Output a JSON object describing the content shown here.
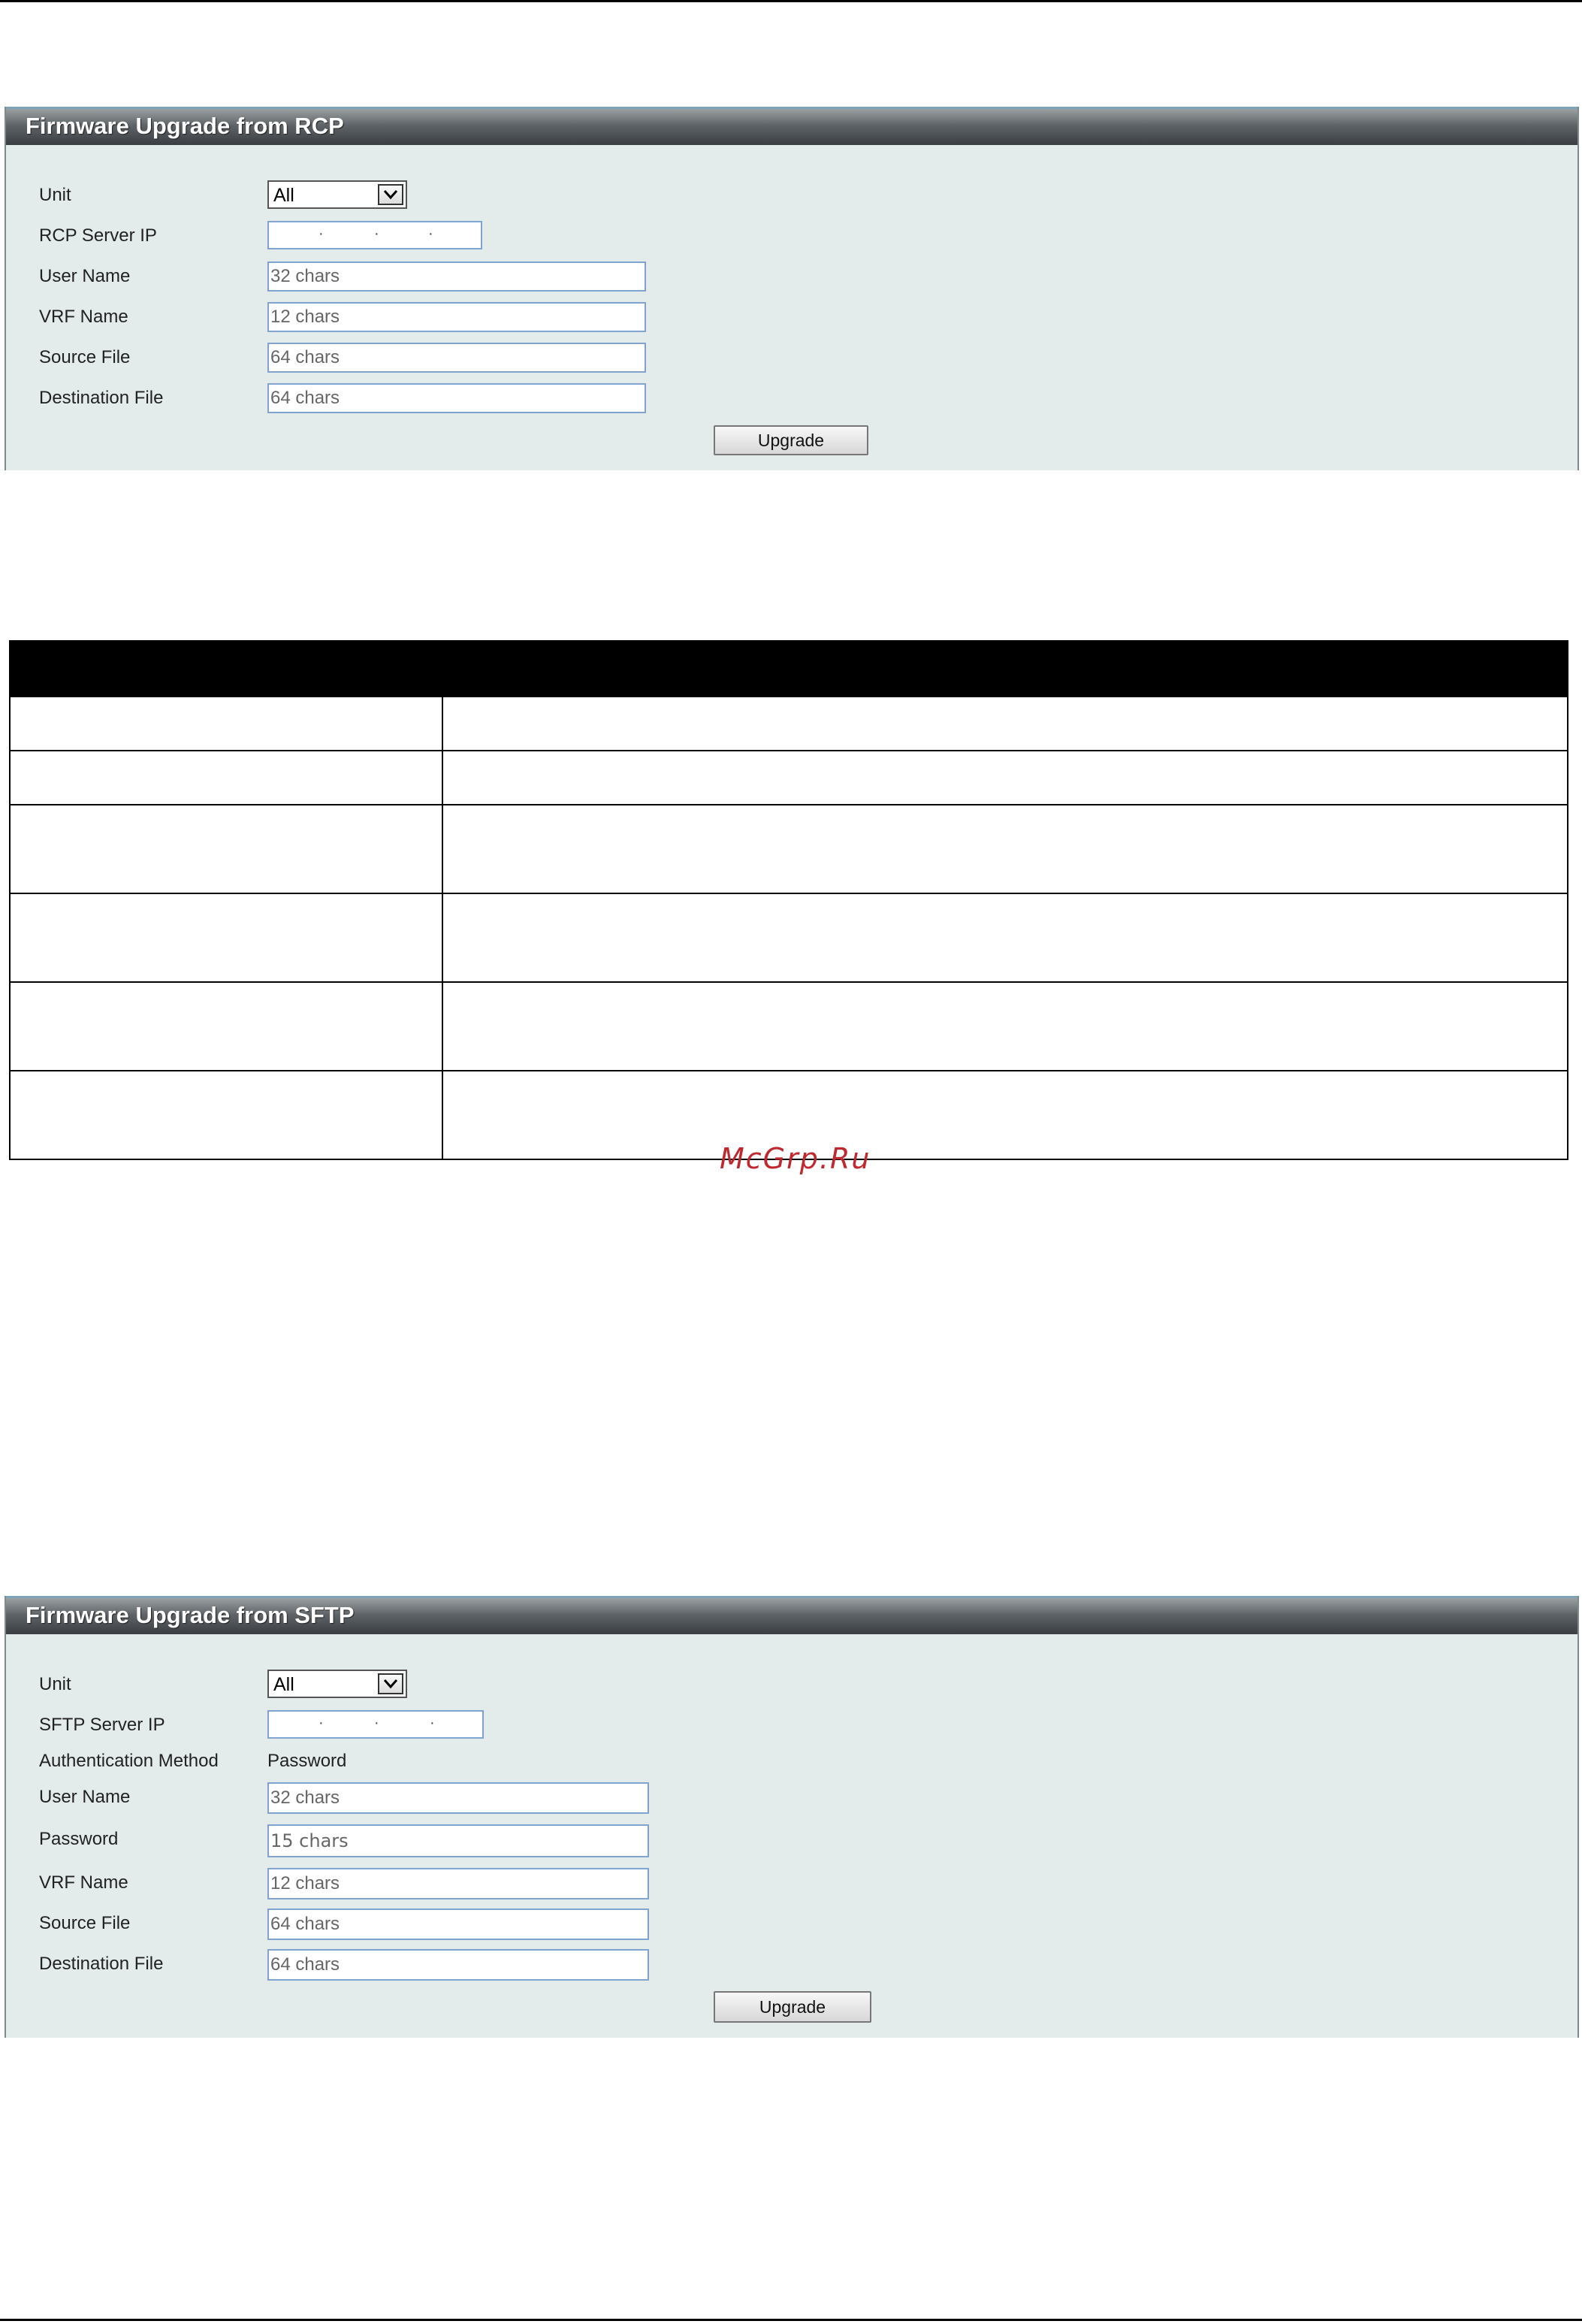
{
  "rcp_panel": {
    "title": "Firmware Upgrade from RCP",
    "unit_label": "Unit",
    "unit_value": "All",
    "server_ip_label": "RCP Server IP",
    "user_name_label": "User Name",
    "user_name_placeholder": "32 chars",
    "vrf_name_label": "VRF Name",
    "vrf_name_placeholder": "12 chars",
    "source_file_label": "Source File",
    "source_file_placeholder": "64 chars",
    "destination_file_label": "Destination File",
    "destination_file_placeholder": "64 chars",
    "upgrade_button": "Upgrade"
  },
  "watermark": "McGrp.Ru",
  "sftp_panel": {
    "title": "Firmware Upgrade from SFTP",
    "unit_label": "Unit",
    "unit_value": "All",
    "server_ip_label": "SFTP Server IP",
    "auth_method_label": "Authentication Method",
    "auth_method_value": "Password",
    "user_name_label": "User Name",
    "user_name_placeholder": "32 chars",
    "password_label": "Password",
    "password_placeholder": "15 chars",
    "vrf_name_label": "VRF Name",
    "vrf_name_placeholder": "12 chars",
    "source_file_label": "Source File",
    "source_file_placeholder": "64 chars",
    "destination_file_label": "Destination File",
    "destination_file_placeholder": "64 chars",
    "upgrade_button": "Upgrade"
  },
  "icons": {
    "dropdown": "chevron-down-icon"
  },
  "colors": {
    "panel_background": "#e4ebeb",
    "field_border": "#7ea4cf",
    "watermark": "#c0282d"
  }
}
